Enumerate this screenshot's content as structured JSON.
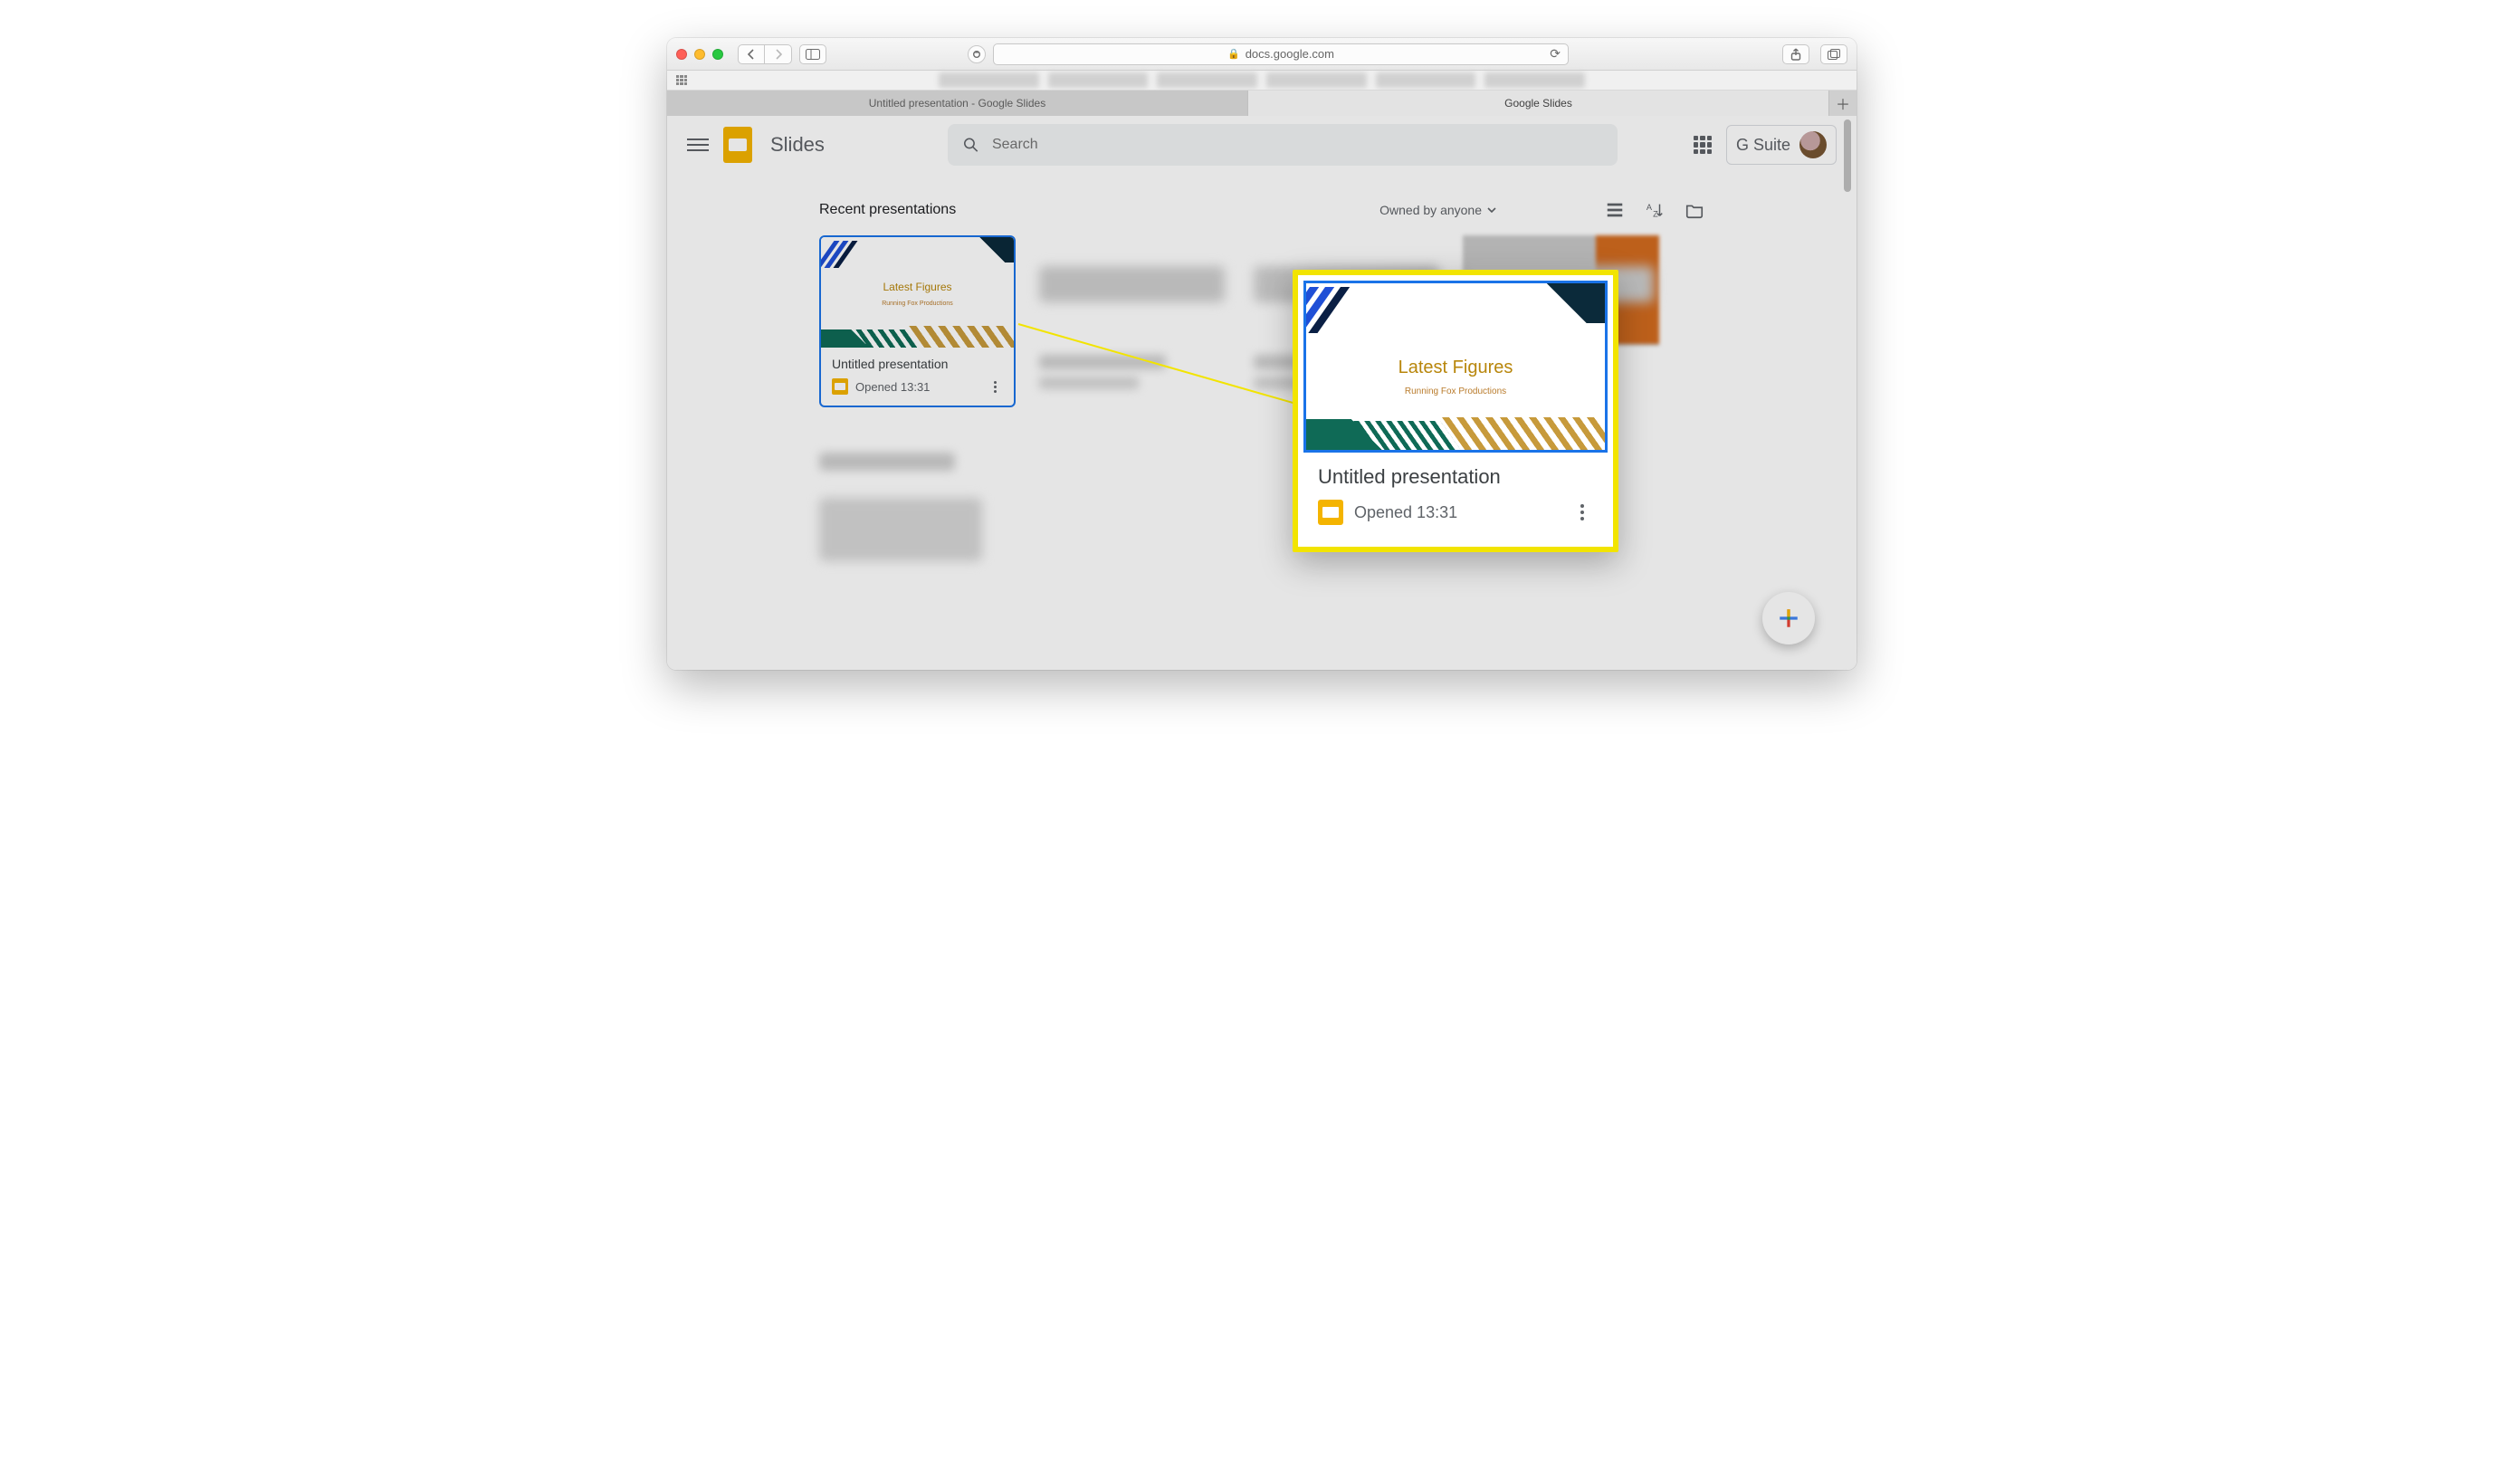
{
  "safari": {
    "url_host": "docs.google.com",
    "tabs": [
      {
        "label": "Untitled presentation - Google Slides",
        "active": false
      },
      {
        "label": "Google Slides",
        "active": true
      }
    ]
  },
  "header": {
    "app_name": "Slides",
    "search_placeholder": "Search",
    "gsuite_label": "G Suite"
  },
  "section": {
    "title": "Recent presentations",
    "filter_label": "Owned by anyone"
  },
  "cards": [
    {
      "slide_title": "Latest Figures",
      "slide_subtitle": "Running Fox Productions",
      "name": "Untitled presentation",
      "opened_label": "Opened 13:31",
      "selected": true
    }
  ],
  "callout": {
    "slide_title": "Latest Figures",
    "slide_subtitle": "Running Fox Productions",
    "name": "Untitled presentation",
    "opened_label": "Opened 13:31"
  }
}
